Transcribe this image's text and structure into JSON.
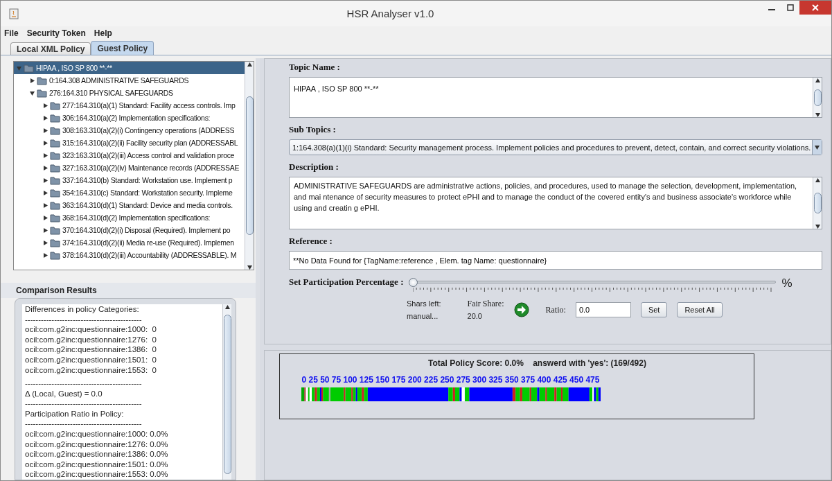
{
  "window": {
    "title": "HSR Analyser v1.0"
  },
  "menu": [
    "File",
    "Security Token",
    "Help"
  ],
  "tabs": [
    {
      "label": "Local XML Policy",
      "selected": false
    },
    {
      "label": "Guest Policy",
      "selected": true
    }
  ],
  "tree": [
    {
      "label": "HIPAA , ISO SP 800 **-**",
      "expanded": true,
      "selected": true,
      "children": [
        {
          "label": "0:164.308 ADMINISTRATIVE SAFEGUARDS",
          "expanded": false,
          "selected": false
        },
        {
          "label": "276:164.310 PHYSICAL SAFEGUARDS",
          "expanded": true,
          "selected": false,
          "children": [
            {
              "label": "277:164.310(a)(1) Standard: Facility access controls. Imp",
              "expanded": false,
              "selected": false
            },
            {
              "label": "306:164.310(a)(2) Implementation specifications:",
              "expanded": false,
              "selected": false
            },
            {
              "label": "308:163.310(a)(2)(i) Contingency operations (ADDRESS",
              "expanded": false,
              "selected": false
            },
            {
              "label": "315:164.310(a)(2)(ii) Facility security plan (ADDRESSABL",
              "expanded": false,
              "selected": false
            },
            {
              "label": "323:163.310(a)(2)(iii) Access control and validation proce",
              "expanded": false,
              "selected": false
            },
            {
              "label": "327:163.310(a)(2)(iv) Maintenance records (ADDRESSAE",
              "expanded": false,
              "selected": false
            },
            {
              "label": "337:164.310(b) Standard: Workstation use. Implement p",
              "expanded": false,
              "selected": false
            },
            {
              "label": "354:164.310(c) Standard: Workstation security. Impleme",
              "expanded": false,
              "selected": false
            },
            {
              "label": "363:164.310(d)(1) Standard: Device and media controls.",
              "expanded": false,
              "selected": false
            },
            {
              "label": "368:164.310(d)(2) Implementation specifications:",
              "expanded": false,
              "selected": false
            },
            {
              "label": "370:164.310(d)(2)(i) Disposal (Required). Implement po",
              "expanded": false,
              "selected": false
            },
            {
              "label": "374:164.310(d)(2)(ii) Media re-use (Required). Implemen",
              "expanded": false,
              "selected": false
            },
            {
              "label": "378:164.310(d)(2)(iii) Accountability (ADDRESSABLE). M",
              "expanded": false,
              "selected": false
            }
          ]
        }
      ]
    }
  ],
  "comparison": {
    "title": "Comparison Results",
    "lines": [
      {
        "kind": "text",
        "text": "Differences in policy Categories:"
      },
      {
        "kind": "text",
        "text": "--------------------------------------------"
      },
      {
        "kind": "text",
        "text": "ocil:com.g2inc:questionnaire:1000:  0"
      },
      {
        "kind": "text",
        "text": "ocil:com.g2inc:questionnaire:1276:  0"
      },
      {
        "kind": "text",
        "text": "ocil:com.g2inc:questionnaire:1386:  0"
      },
      {
        "kind": "text",
        "text": "ocil:com.g2inc:questionnaire:1501:  0"
      },
      {
        "kind": "text",
        "text": "ocil:com.g2inc:questionnaire:1553:  0"
      },
      {
        "kind": "spacer"
      },
      {
        "kind": "text",
        "text": "--------------------------------------------"
      },
      {
        "kind": "text",
        "text": "Δ (Local, Guest) = 0.0"
      },
      {
        "kind": "text",
        "text": "--------------------------------------------"
      },
      {
        "kind": "text",
        "text": "Participation Ratio in Policy:"
      },
      {
        "kind": "text",
        "text": "--------------------------------------------"
      },
      {
        "kind": "text",
        "text": "ocil:com.g2inc:questionnaire:1000: 0.0%"
      },
      {
        "kind": "text",
        "text": "ocil:com.g2inc:questionnaire:1276: 0.0%"
      },
      {
        "kind": "text",
        "text": "ocil:com.g2inc:questionnaire:1386: 0.0%"
      },
      {
        "kind": "text",
        "text": "ocil:com.g2inc:questionnaire:1501: 0.0%"
      },
      {
        "kind": "text",
        "text": "ocil:com.g2inc:questionnaire:1553: 0.0%"
      }
    ]
  },
  "topic": {
    "label": "Topic Name  :",
    "value": "HIPAA , ISO SP 800 **-**"
  },
  "sub_topics": {
    "label": "Sub Topics   :",
    "value": "1:164.308(a)(1)(i) Standard: Security management process. Implement policies and procedures to prevent, detect, contain, and correct security violations."
  },
  "description": {
    "label": "Description :",
    "value": "ADMINISTRATIVE SAFEGUARDS are administrative actions, policies, and procedures, used to manage the selection, development, implementation, and mai ntenance of security measures to protect ePHI and to manage the conduct of the covered entity's and business associate's workforce while using and creatin g ePHI."
  },
  "reference": {
    "label": "Reference :",
    "value": "**No Data Found for {TagName:reference , Elem. tag Name: questionnaire}"
  },
  "participation": {
    "label": "Set Participation Percentage :",
    "level": 0,
    "unit": "%"
  },
  "shares": {
    "left_label": "Shars left:",
    "left_value": "manual...",
    "fair_label": "Fair Share:",
    "fair_value": "20.0",
    "ratio_label": "Ratio:",
    "ratio_value": "0.0",
    "buttons": [
      "Set",
      "Reset All"
    ]
  },
  "score": {
    "title": "Total Policy Score: 0.0%    answerd with 'yes': (169/492)",
    "axis": [
      "0",
      "25",
      "50",
      "75",
      "100",
      "125",
      "150",
      "175",
      "200",
      "225",
      "250",
      "275",
      "300",
      "325",
      "350",
      "375",
      "400",
      "425",
      "450",
      "475"
    ]
  }
}
